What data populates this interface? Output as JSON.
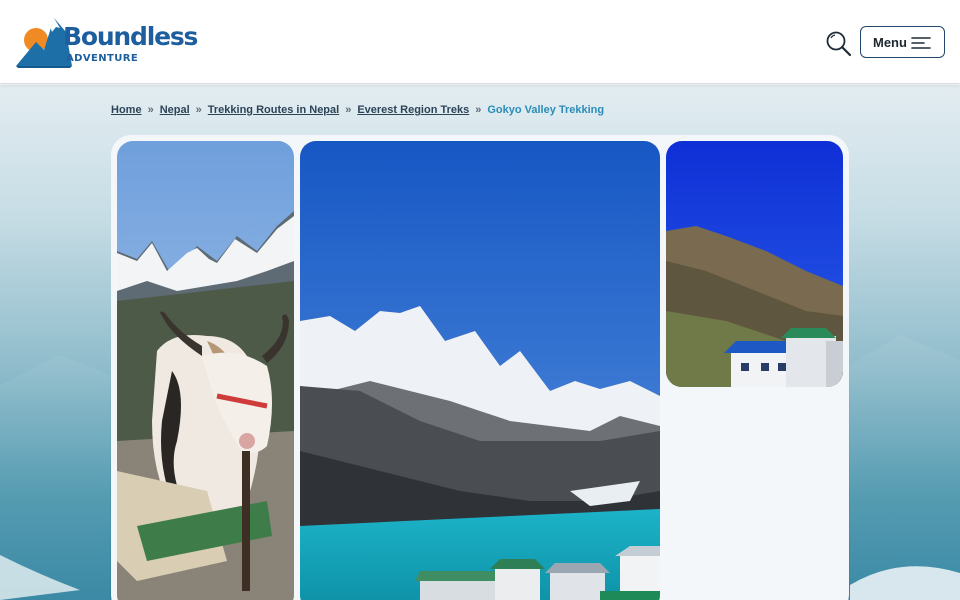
{
  "site": {
    "logo_word": "Boundless",
    "logo_sub": "ADVENTURE",
    "brand_colors": {
      "primary": "#1d5f9e",
      "accent": "#f08a24",
      "highlight": "#2b8cb8"
    }
  },
  "header": {
    "search_icon": "search-icon",
    "menu_label": "Menu",
    "menu_icon": "hamburger-icon"
  },
  "breadcrumb": {
    "items": [
      "Home",
      "Nepal",
      "Trekking Routes in Nepal",
      "Everest Region Treks"
    ],
    "current": "Gokyo Valley Trekking",
    "separator": "»"
  },
  "gallery": {
    "photos": [
      {
        "subject": "yak in front of snowy mountains"
      },
      {
        "subject": "Gokyo lake with snow-capped peaks and lodges"
      },
      {
        "subject": "mountain slope with teahouse lodges"
      }
    ]
  }
}
